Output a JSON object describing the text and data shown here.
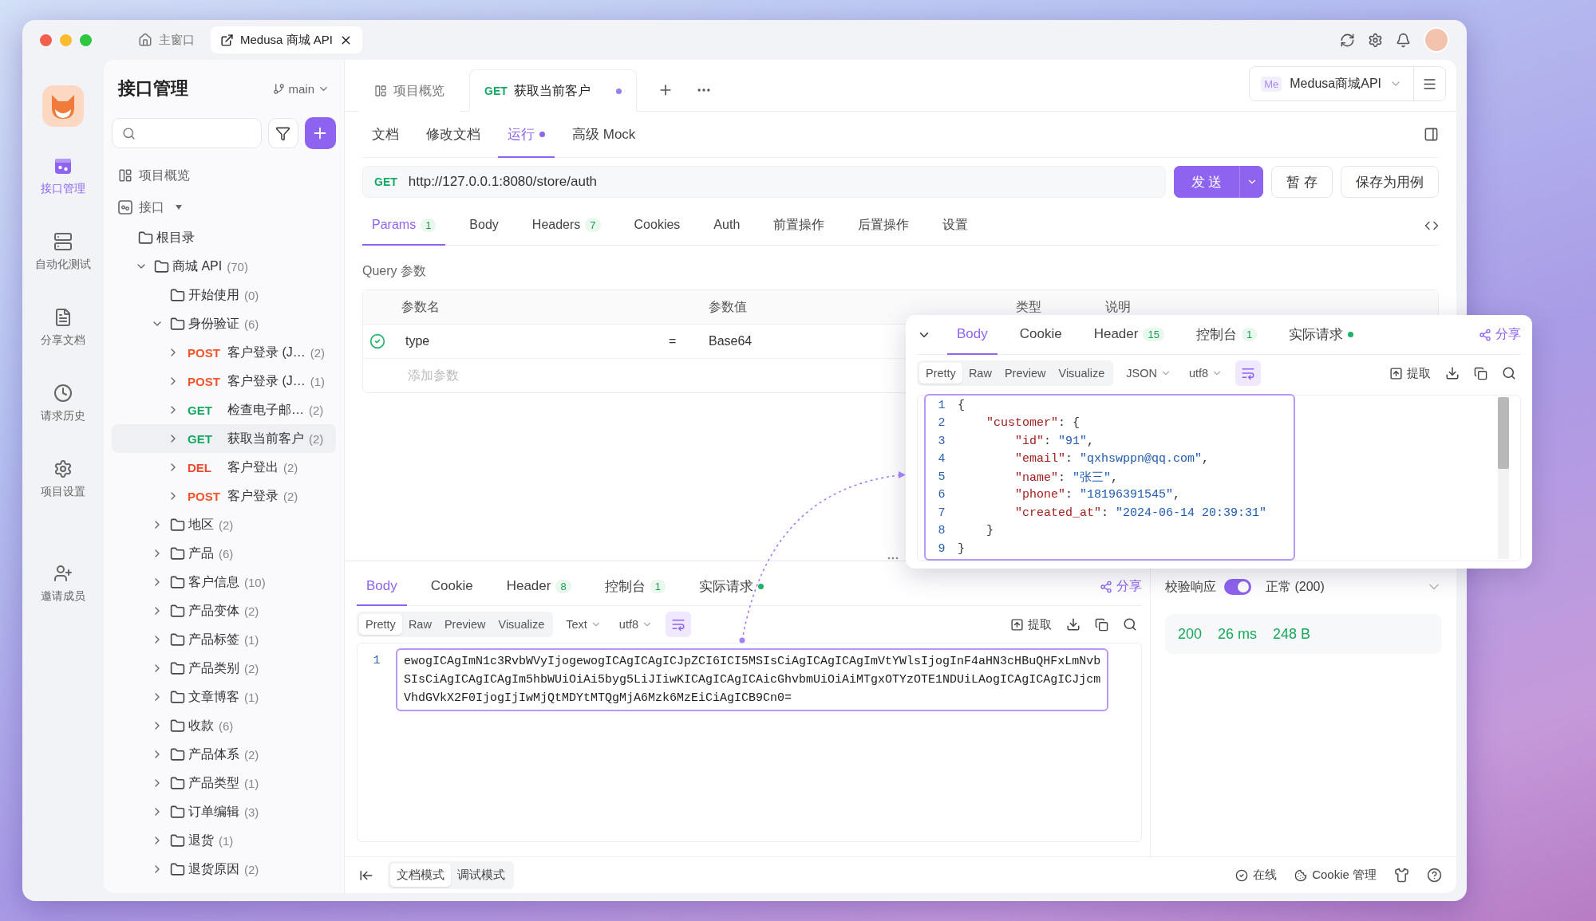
{
  "titlebar": {
    "tabs": [
      {
        "kind": "home",
        "label": "主窗口",
        "selected": false,
        "closable": false
      },
      {
        "kind": "project",
        "label": "Medusa 商城 API",
        "selected": true,
        "closable": true
      }
    ]
  },
  "rail": {
    "items": [
      {
        "kind": "api",
        "label": "接口管理",
        "selected": true
      },
      {
        "kind": "automation",
        "label": "自动化测试",
        "selected": false
      },
      {
        "kind": "share",
        "label": "分享文档",
        "selected": false
      },
      {
        "kind": "history",
        "label": "请求历史",
        "selected": false
      },
      {
        "kind": "settings",
        "label": "项目设置",
        "selected": false
      },
      {
        "kind": "invite",
        "label": "邀请成员",
        "selected": false
      }
    ]
  },
  "tree_panel": {
    "title": "接口管理",
    "branch": "main",
    "top_items": [
      {
        "kind": "overview",
        "label": "项目概览"
      },
      {
        "kind": "section",
        "label": "接口"
      }
    ],
    "tree": [
      {
        "kind": "folder",
        "label": "根目录",
        "selected": false,
        "children": [
          {
            "kind": "folder",
            "label": "商城 API",
            "count": "(70)",
            "expanded": true,
            "selected": false,
            "children": [
              {
                "kind": "folder",
                "label": "开始使用",
                "count": "(0)",
                "selected": false
              },
              {
                "kind": "folder",
                "label": "身份验证",
                "count": "(6)",
                "expanded": true,
                "selected": false,
                "children": [
                  {
                    "kind": "request",
                    "method": "POST",
                    "label": "客户登录 (J…",
                    "count": "(2)",
                    "expanded": false,
                    "selected": false
                  },
                  {
                    "kind": "request",
                    "method": "POST",
                    "label": "客户登录 (J…",
                    "count": "(1)",
                    "expanded": false,
                    "selected": false
                  },
                  {
                    "kind": "request",
                    "method": "GET",
                    "label": "检查电子邮…",
                    "count": "(2)",
                    "expanded": false,
                    "selected": false
                  },
                  {
                    "kind": "request",
                    "method": "GET",
                    "label": "获取当前客户",
                    "count": "(2)",
                    "expanded": false,
                    "selected": true
                  },
                  {
                    "kind": "request",
                    "method": "DEL",
                    "label": "客户登出",
                    "count": "(2)",
                    "expanded": false,
                    "selected": false
                  },
                  {
                    "kind": "request",
                    "method": "POST",
                    "label": "客户登录",
                    "count": "(2)",
                    "expanded": false,
                    "selected": false
                  }
                ]
              },
              {
                "kind": "folder",
                "label": "地区",
                "count": "(2)",
                "expanded": false,
                "selected": false
              },
              {
                "kind": "folder",
                "label": "产品",
                "count": "(6)",
                "expanded": false,
                "selected": false
              },
              {
                "kind": "folder",
                "label": "客户信息",
                "count": "(10)",
                "expanded": false,
                "selected": false
              },
              {
                "kind": "folder",
                "label": "产品变体",
                "count": "(2)",
                "expanded": false,
                "selected": false
              },
              {
                "kind": "folder",
                "label": "产品标签",
                "count": "(1)",
                "expanded": false,
                "selected": false
              },
              {
                "kind": "folder",
                "label": "产品类别",
                "count": "(2)",
                "expanded": false,
                "selected": false
              },
              {
                "kind": "folder",
                "label": "文章博客",
                "count": "(1)",
                "expanded": false,
                "selected": false
              },
              {
                "kind": "folder",
                "label": "收款",
                "count": "(6)",
                "expanded": false,
                "selected": false
              },
              {
                "kind": "folder",
                "label": "产品体系",
                "count": "(2)",
                "expanded": false,
                "selected": false
              },
              {
                "kind": "folder",
                "label": "产品类型",
                "count": "(1)",
                "expanded": false,
                "selected": false
              },
              {
                "kind": "folder",
                "label": "订单编辑",
                "count": "(3)",
                "expanded": false,
                "selected": false
              },
              {
                "kind": "folder",
                "label": "退货",
                "count": "(1)",
                "expanded": false,
                "selected": false
              },
              {
                "kind": "folder",
                "label": "退货原因",
                "count": "(2)",
                "expanded": false,
                "selected": false
              }
            ]
          }
        ]
      }
    ]
  },
  "main": {
    "doc_tabs": [
      {
        "kind": "overview",
        "label": "项目概览",
        "selected": false,
        "unsaved": false
      },
      {
        "kind": "request",
        "method": "GET",
        "label": "获取当前客户",
        "selected": true,
        "unsaved": true
      }
    ],
    "project_selector": {
      "badge": "Me",
      "label": "Medusa商城API"
    },
    "view_tabs": [
      {
        "label": "文档",
        "selected": false,
        "dot": false
      },
      {
        "label": "修改文档",
        "selected": false,
        "dot": false
      },
      {
        "label": "运行",
        "selected": true,
        "dot": true
      },
      {
        "label": "高级 Mock",
        "selected": false,
        "dot": false
      }
    ],
    "request": {
      "method": "GET",
      "url": "http://127.0.0.1:8080/store/auth",
      "send": "发 送",
      "save": "暂 存",
      "save_case": "保存为用例"
    },
    "param_tabs": [
      {
        "label": "Params",
        "count": "1",
        "selected": true
      },
      {
        "label": "Body",
        "selected": false
      },
      {
        "label": "Headers",
        "count": "7",
        "selected": false
      },
      {
        "label": "Cookies",
        "selected": false
      },
      {
        "label": "Auth",
        "selected": false
      },
      {
        "label": "前置操作",
        "selected": false
      },
      {
        "label": "后置操作",
        "selected": false
      },
      {
        "label": "设置",
        "selected": false
      }
    ],
    "query": {
      "title": "Query 参数",
      "columns": [
        "参数名",
        "参数值",
        "类型",
        "说明"
      ],
      "rows": [
        {
          "enabled": true,
          "name": "type",
          "operator": "=",
          "value": "Base64"
        }
      ],
      "add_placeholder": "添加参数"
    }
  },
  "response": {
    "tabs": [
      {
        "label": "Body",
        "selected": true,
        "dot": false
      },
      {
        "label": "Cookie",
        "selected": false,
        "dot": false
      },
      {
        "label": "Header",
        "count": "8",
        "selected": false,
        "dot": false
      },
      {
        "label": "控制台",
        "count": "1",
        "selected": false,
        "dot": false
      },
      {
        "label": "实际请求",
        "selected": false,
        "dot": true
      }
    ],
    "share": "分享",
    "views": [
      {
        "label": "Pretty",
        "selected": true
      },
      {
        "label": "Raw",
        "selected": false
      },
      {
        "label": "Preview",
        "selected": false
      },
      {
        "label": "Visualize",
        "selected": false
      }
    ],
    "format": "Text",
    "encoding": "utf8",
    "wrap_on": true,
    "extract": "提取",
    "lines": [
      {
        "number": "1",
        "text": "ewogICAgImN1c3RvbWVyIjogewogICAgICAgICJpZCI6ICI5MSIsCiAgICAgICAgImVtYWlsIjogInF4aHN3cHBuQHFxLmNvbSIsCiAgICAgICAgIm5hbWUiOiAi5byg5LiJIiwKICAgICAgICAicGhvbmUiOiAiMTgxOTYzOTE1NDUiLAogICAgICAgICJjcmVhdGVkX2F0IjogIjIwMjQtMDYtMTQgMjA6Mzk6MzEiCiAgICB9Cn0="
      }
    ]
  },
  "validation": {
    "label": "校验响应",
    "on": true,
    "status": "正常 (200)",
    "code": "200",
    "time": "26 ms",
    "size": "248 B"
  },
  "footer": {
    "modes": [
      {
        "label": "文档模式",
        "selected": true
      },
      {
        "label": "调试模式",
        "selected": false
      }
    ],
    "online": "在线",
    "cookie": "Cookie 管理"
  },
  "popup": {
    "tabs": [
      {
        "label": "Body",
        "selected": true,
        "dot": false
      },
      {
        "label": "Cookie",
        "selected": false,
        "dot": false
      },
      {
        "label": "Header",
        "count": "15",
        "selected": false,
        "dot": false
      },
      {
        "label": "控制台",
        "count": "1",
        "selected": false,
        "dot": false
      },
      {
        "label": "实际请求",
        "selected": false,
        "dot": true
      }
    ],
    "share": "分享",
    "views": [
      {
        "label": "Pretty",
        "selected": true
      },
      {
        "label": "Raw",
        "selected": false
      },
      {
        "label": "Preview",
        "selected": false
      },
      {
        "label": "Visualize",
        "selected": false
      }
    ],
    "format": "JSON",
    "encoding": "utf8",
    "wrap_on": true,
    "extract": "提取",
    "lines": [
      {
        "number": "1",
        "tokens": [
          {
            "kind": "punct",
            "text": "{"
          }
        ]
      },
      {
        "number": "2",
        "tokens": [
          {
            "kind": "key",
            "text": "    \"customer\""
          },
          {
            "kind": "punct",
            "text": ": {"
          }
        ]
      },
      {
        "number": "3",
        "tokens": [
          {
            "kind": "key",
            "text": "        \"id\""
          },
          {
            "kind": "punct",
            "text": ": "
          },
          {
            "kind": "string",
            "text": "\"91\""
          },
          {
            "kind": "punct",
            "text": ","
          }
        ]
      },
      {
        "number": "4",
        "tokens": [
          {
            "kind": "key",
            "text": "        \"email\""
          },
          {
            "kind": "punct",
            "text": ": "
          },
          {
            "kind": "string",
            "text": "\"qxhswppn@qq.com\""
          },
          {
            "kind": "punct",
            "text": ","
          }
        ]
      },
      {
        "number": "5",
        "tokens": [
          {
            "kind": "key",
            "text": "        \"name\""
          },
          {
            "kind": "punct",
            "text": ": "
          },
          {
            "kind": "string",
            "text": "\"张三\""
          },
          {
            "kind": "punct",
            "text": ","
          }
        ]
      },
      {
        "number": "6",
        "tokens": [
          {
            "kind": "key",
            "text": "        \"phone\""
          },
          {
            "kind": "punct",
            "text": ": "
          },
          {
            "kind": "string",
            "text": "\"18196391545\""
          },
          {
            "kind": "punct",
            "text": ","
          }
        ]
      },
      {
        "number": "7",
        "tokens": [
          {
            "kind": "key",
            "text": "        \"created_at\""
          },
          {
            "kind": "punct",
            "text": ": "
          },
          {
            "kind": "string",
            "text": "\"2024-06-14 20:39:31\""
          }
        ]
      },
      {
        "number": "8",
        "tokens": [
          {
            "kind": "punct",
            "text": "    }"
          }
        ]
      },
      {
        "number": "9",
        "tokens": [
          {
            "kind": "punct",
            "text": "}"
          }
        ]
      }
    ]
  }
}
